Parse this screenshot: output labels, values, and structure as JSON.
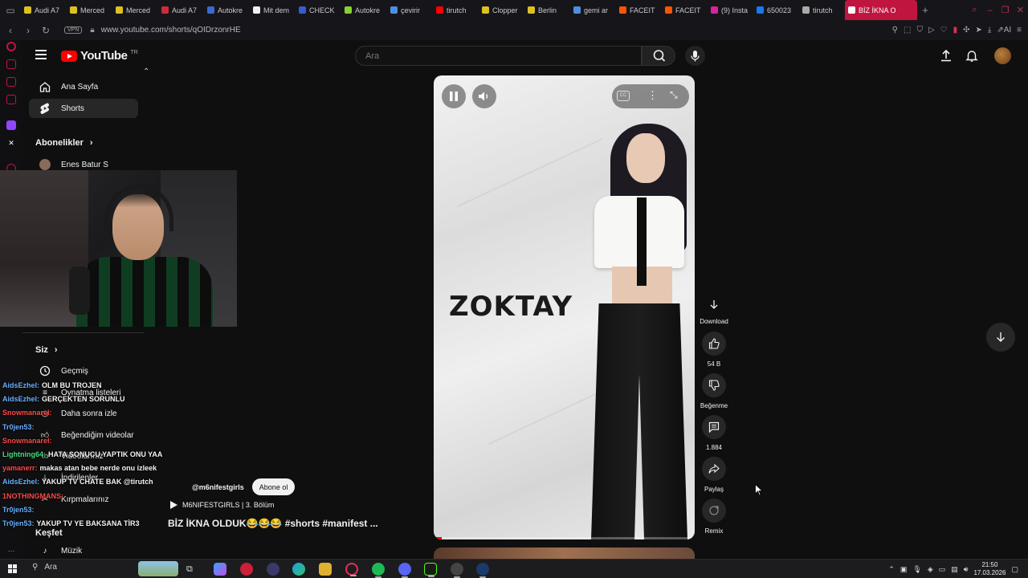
{
  "browser": {
    "tabs": [
      {
        "label": "Audi A7",
        "color": "#e0c020"
      },
      {
        "label": "Merced",
        "color": "#e0c020"
      },
      {
        "label": "Merced",
        "color": "#e0c020"
      },
      {
        "label": "Audi A7",
        "color": "#d02a3a"
      },
      {
        "label": "Autokre",
        "color": "#3a6ad0"
      },
      {
        "label": "Mit dem",
        "color": "#f0f0f0"
      },
      {
        "label": "CHECK",
        "color": "#3a5ad0"
      },
      {
        "label": "Autokre",
        "color": "#8ad030"
      },
      {
        "label": "çevirir",
        "color": "#4a90e2"
      },
      {
        "label": "tirutch",
        "color": "#ff0000"
      },
      {
        "label": "Clopper",
        "color": "#e0c020"
      },
      {
        "label": "Berlin",
        "color": "#e0c020"
      },
      {
        "label": "gemi ar",
        "color": "#4a90e2"
      },
      {
        "label": "FACEIT",
        "color": "#ff5500"
      },
      {
        "label": "FACEIT",
        "color": "#ff5500"
      },
      {
        "label": "(9) Insta",
        "color": "#d6249f"
      },
      {
        "label": "650023",
        "color": "#1877f2"
      },
      {
        "label": "tirutch",
        "color": "#aaaaaa"
      }
    ],
    "active_tab": "BİZ İKNA O",
    "url": "www.youtube.com/shorts/qOIDrzonrHE",
    "vpn_label": "VPN"
  },
  "youtube": {
    "logo_text": "YouTube",
    "logo_region": "TR",
    "search_placeholder": "Ara",
    "sidebar": {
      "home": "Ana Sayfa",
      "shorts": "Shorts",
      "subscriptions_heading": "Abonelikler",
      "subscription_channel": "Enes Batur S",
      "you_heading": "Siz",
      "history": "Geçmiş",
      "playlists": "Oynatma listeleri",
      "watch_later": "Daha sonra izle",
      "liked": "Beğendiğim videolar",
      "videos": "Videolarınız",
      "downloads": "İndirilenler",
      "your_clips": "Kırpmalarınız",
      "explore_heading": "Keşfet",
      "music": "Müzik"
    },
    "short": {
      "overlay_text": "ZOKTAY",
      "channel": "@m6nifestgirls",
      "subscribe_label": "Abone ol",
      "playlist": "M6NIFESTGIRLS | 3. Bölüm",
      "title": "BİZ İKNA OLDUK😂😂😂 #shorts #manifest ...",
      "progress": 0.03
    },
    "actions": {
      "download": "Download",
      "likes": "54 B",
      "dislike": "Beğenme",
      "comments": "1.884",
      "share": "Paylaş",
      "remix": "Remix"
    }
  },
  "chat": [
    {
      "user": "AidsEzhel:",
      "text": "OLM BU TROJEN",
      "color": "#6ab0ff"
    },
    {
      "user": "AidsEzhel:",
      "text": "GERÇEKTEN SORUNLU",
      "color": "#6ab0ff"
    },
    {
      "user": "Snowmanarel:",
      "text": "",
      "color": "#ff4a4a"
    },
    {
      "user": "Tr0jen53:",
      "text": "",
      "color": "#6ab0ff"
    },
    {
      "user": "Snowmanarel:",
      "text": "",
      "color": "#ff4a4a"
    },
    {
      "user": "Lightning64:",
      "text": "HATA SONUCU YAPTIK ONU YAA",
      "color": "#4ade80"
    },
    {
      "user": "yamanerr:",
      "text": "makas atan bebe nerde onu izleek",
      "color": "#ff4a4a"
    },
    {
      "user": "AidsEzhel:",
      "text": "YAKUP TV CHATE BAK @tirutch",
      "color": "#6ab0ff"
    },
    {
      "user": "1NOTHINGMANS:",
      "text": "",
      "color": "#ff4a4a"
    },
    {
      "user": "Tr0jen53:",
      "text": "",
      "color": "#6ab0ff"
    },
    {
      "user": "Tr0jen53:",
      "text": "YAKUP TV YE BAKSANA TİR3",
      "color": "#6ab0ff"
    }
  ],
  "taskbar": {
    "search_label": "Ara",
    "time": "21:50",
    "date": "17.03.2026"
  }
}
